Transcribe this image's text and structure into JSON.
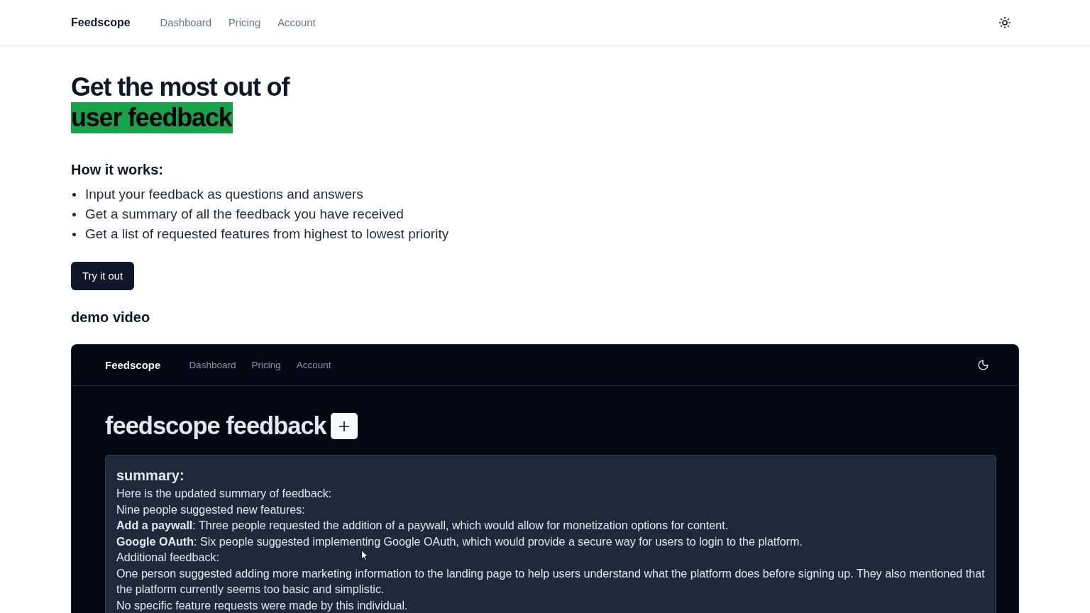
{
  "header": {
    "logo": "Feedscope",
    "nav": [
      "Dashboard",
      "Pricing",
      "Account"
    ]
  },
  "hero": {
    "title": "Get the most out of",
    "highlight": "user feedback"
  },
  "how_it_works": {
    "heading": "How it works:",
    "items": [
      "Input your feedback as questions and answers",
      "Get a summary of all the feedback you have received",
      "Get a list of requested features from highest to lowest priority"
    ]
  },
  "cta_button": "Try it out",
  "demo": {
    "heading": "demo video",
    "frame": {
      "header": {
        "logo": "Feedscope",
        "nav": [
          "Dashboard",
          "Pricing",
          "Account"
        ]
      },
      "title": "feedscope feedback",
      "summary": {
        "heading": "summary:",
        "lines": [
          "Here is the updated summary of feedback:",
          "Nine people suggested new features:",
          "**Add a paywall**: Three people requested the addition of a paywall, which would allow for monetization options for content.",
          "**Google OAuth**: Six people suggested implementing Google OAuth, which would provide a secure way for users to login to the platform.",
          "Additional feedback:",
          "One person suggested adding more marketing information to the landing page to help users understand what the platform does before signing up. They also mentioned that the platform currently seems too basic and simplistic.",
          "No specific feature requests were made by this individual."
        ]
      }
    }
  }
}
